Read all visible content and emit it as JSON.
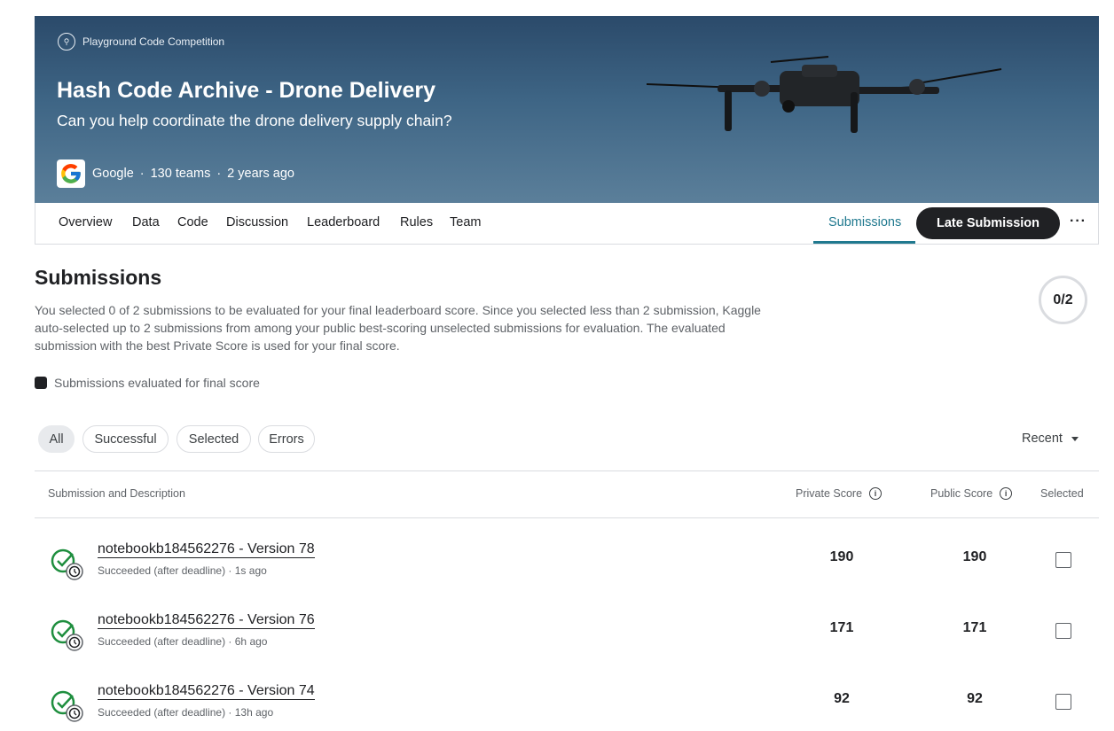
{
  "banner": {
    "competition_type": "Playground Code Competition",
    "title": "Hash Code Archive - Drone Delivery",
    "subtitle": "Can you help coordinate the drone delivery supply chain?",
    "host": "Google",
    "teams": "130 teams",
    "age": "2 years ago",
    "separator": "·"
  },
  "nav": {
    "tabs": [
      "Overview",
      "Data",
      "Code",
      "Discussion",
      "Leaderboard",
      "Rules",
      "Team"
    ],
    "submissions_tab": "Submissions",
    "late_submission": "Late Submission",
    "more": "···"
  },
  "submissions": {
    "title": "Submissions",
    "description": "You selected 0 of 2 submissions to be evaluated for your final leaderboard score. Since you selected less than 2 submission, Kaggle auto-selected up to 2 submissions from among your public best-scoring unselected submissions for evaluation. The evaluated submission with the best Private Score is used for your final score.",
    "counter": "0/2",
    "legend": "Submissions evaluated for final score"
  },
  "filters": [
    "All",
    "Successful",
    "Selected",
    "Errors"
  ],
  "sort": {
    "label": "Recent"
  },
  "table": {
    "headers": {
      "description": "Submission and Description",
      "private": "Private Score",
      "public": "Public Score",
      "selected": "Selected"
    },
    "rows": [
      {
        "title": "notebookb184562276 - Version 78",
        "meta": "Succeeded (after deadline) · 1s ago",
        "private": "190",
        "public": "190",
        "selected": false
      },
      {
        "title": "notebookb184562276 - Version 76",
        "meta": "Succeeded (after deadline) · 6h ago",
        "private": "171",
        "public": "171",
        "selected": false
      },
      {
        "title": "notebookb184562276 - Version 74",
        "meta": "Succeeded (after deadline) · 13h ago",
        "private": "92",
        "public": "92",
        "selected": false
      }
    ]
  },
  "colors": {
    "accent": "#20798f",
    "success": "#1e8e3e",
    "dark": "#202124"
  }
}
